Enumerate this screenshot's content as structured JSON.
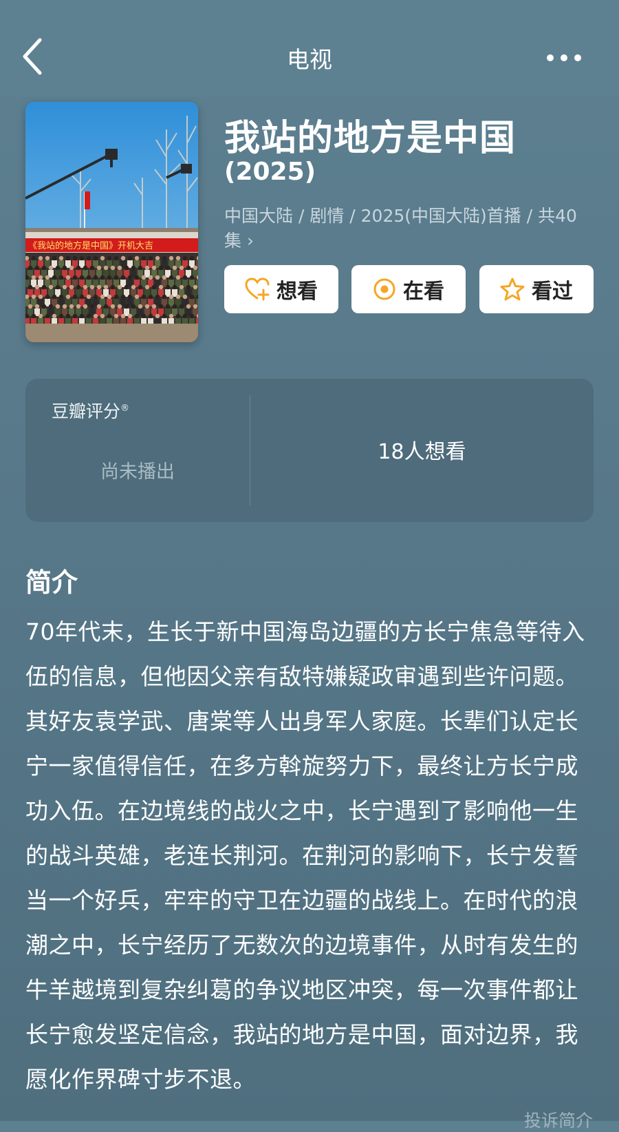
{
  "header": {
    "title": "电视"
  },
  "show": {
    "title": "我站的地方是中国",
    "year": "(2025)",
    "meta": "中国大陆 / 剧情 / 2025(中国大陆)首播 / 共40集 ›",
    "poster_banner": "《我站的地方是中国》开机大吉"
  },
  "actions": {
    "want": "想看",
    "watching": "在看",
    "watched": "看过"
  },
  "rating": {
    "label": "豆瓣评分",
    "status": "尚未播出",
    "want_count": "18人想看"
  },
  "intro": {
    "heading": "简介",
    "text": "70年代末，生长于新中国海岛边疆的方长宁焦急等待入伍的信息，但他因父亲有敌特嫌疑政审遇到些许问题。其好友袁学武、唐棠等人出身军人家庭。长辈们认定长宁一家值得信任，在多方斡旋努力下，最终让方长宁成功入伍。在边境线的战火之中，长宁遇到了影响他一生的战斗英雄，老连长荆河。在荆河的影响下，长宁发誓当一个好兵，牢牢的守卫在边疆的战线上。在时代的浪潮之中，长宁经历了无数次的边境事件，从时有发生的牛羊越境到复杂纠葛的争议地区冲突，每一次事件都让长宁愈发坚定信念，我站的地方是中国，面对边界，我愿化作界碑寸步不退。",
    "report": "投诉简介"
  },
  "colors": {
    "background": "#58798a",
    "card": "#4e6c7b",
    "accent": "#f5a623",
    "banner": "#d21c1c"
  }
}
